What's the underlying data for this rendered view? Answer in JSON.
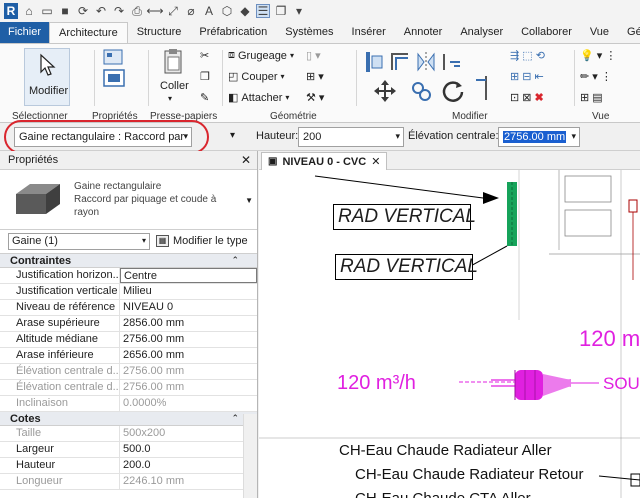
{
  "ribbon_tabs": [
    "Fichier",
    "Architecture",
    "Structure",
    "Préfabrication",
    "Systèmes",
    "Insérer",
    "Annoter",
    "Analyser",
    "Collaborer",
    "Vue",
    "Gérer"
  ],
  "ribbon": {
    "modify_label": "Modifier",
    "paste_label": "Coller",
    "cope": "Grugeage",
    "cut": "Couper",
    "join": "Attacher",
    "panels": {
      "select": "Sélectionner",
      "properties": "Propriétés",
      "clipboard": "Presse-papiers",
      "geometry": "Géométrie",
      "modify": "Modifier",
      "view": "Vue"
    }
  },
  "options_bar": {
    "type_selector": "Gaine rectangulaire : Raccord par",
    "height_label": "Hauteur:",
    "height_value": "200",
    "elevation_label": "Élévation centrale:",
    "elevation_value": "2756.00 mm"
  },
  "properties": {
    "title": "Propriétés",
    "type_line1": "Gaine rectangulaire",
    "type_line2": "Raccord par piquage et coude à rayon",
    "selection": "Gaine (1)",
    "edit_type": "Modifier le type",
    "groups": [
      {
        "name": "Contraintes",
        "rows": [
          {
            "k": "Justification horizon...",
            "v": "Centre"
          },
          {
            "k": "Justification verticale",
            "v": "Milieu"
          },
          {
            "k": "Niveau de référence",
            "v": "NIVEAU 0"
          },
          {
            "k": "Arase supérieure",
            "v": "2856.00 mm"
          },
          {
            "k": "Altitude médiane",
            "v": "2756.00 mm"
          },
          {
            "k": "Arase inférieure",
            "v": "2656.00 mm"
          },
          {
            "k": "Élévation centrale d...",
            "v": "2756.00 mm"
          },
          {
            "k": "Élévation centrale d...",
            "v": "2756.00 mm"
          },
          {
            "k": "Inclinaison",
            "v": "0.0000%"
          }
        ]
      },
      {
        "name": "Cotes",
        "rows": [
          {
            "k": "Taille",
            "v": "500x200"
          },
          {
            "k": "Largeur",
            "v": "500.0"
          },
          {
            "k": "Hauteur",
            "v": "200.0"
          },
          {
            "k": "Longueur",
            "v": "2246.10 mm"
          }
        ]
      }
    ]
  },
  "view": {
    "tab_title": "NIVEAU 0 - CVC",
    "labels": {
      "rad1": "RAD VERTICAL",
      "rad2": "RAD VERTICAL",
      "flow1": "120 m³/h",
      "flow2": "120 m",
      "sou": "SOU",
      "eau_aller": "CH-Eau Chaude Radiateur Aller",
      "eau_retour": "CH-Eau Chaude Radiateur Retour",
      "eau_cta": "CH-Eau Chaude CTA Aller"
    }
  },
  "colors": {
    "accent": "#1f5fa6",
    "magenta": "#e020e0",
    "green": "#16a35a",
    "highlight": "#d9262e"
  }
}
